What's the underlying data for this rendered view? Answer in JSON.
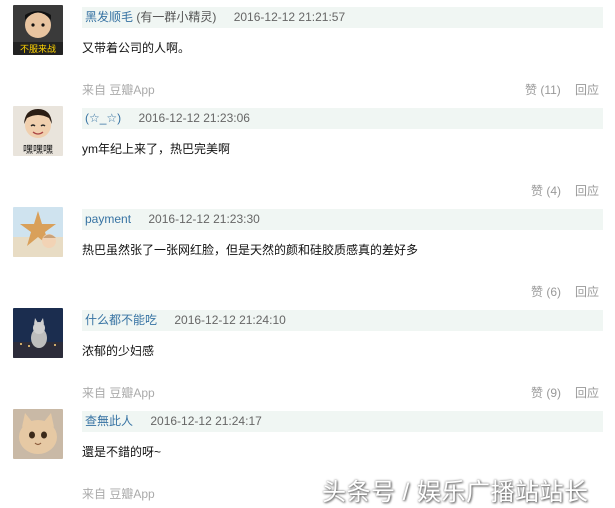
{
  "comments": [
    {
      "username": "黑发顺毛",
      "user_subtitle": "(有一群小精灵)",
      "timestamp": "2016-12-12 21:21:57",
      "text": "又带着公司的人啊。",
      "source": "来自 豆瓣App",
      "likes": "赞 (11)",
      "reply": "回应",
      "avatar_caption": "不服来战"
    },
    {
      "username": "(☆_☆)",
      "user_subtitle": "",
      "timestamp": "2016-12-12 21:23:06",
      "text": "ym年纪上来了，热巴完美啊",
      "source": "",
      "likes": "赞 (4)",
      "reply": "回应",
      "avatar_caption": "嘿嘿嘿"
    },
    {
      "username": "payment",
      "user_subtitle": "",
      "timestamp": "2016-12-12 21:23:30",
      "text": "热巴虽然张了一张网红脸，但是天然的颜和硅胶质感真的差好多",
      "source": "",
      "likes": "赞 (6)",
      "reply": "回应",
      "avatar_caption": ""
    },
    {
      "username": "什么都不能吃",
      "user_subtitle": "",
      "timestamp": "2016-12-12 21:24:10",
      "text": "浓郁的少妇感",
      "source": "来自 豆瓣App",
      "likes": "赞 (9)",
      "reply": "回应",
      "avatar_caption": ""
    },
    {
      "username": "查無此人",
      "user_subtitle": "",
      "timestamp": "2016-12-12 21:24:17",
      "text": "還是不錯的呀~",
      "source": "来自 豆瓣App",
      "likes": "",
      "reply": "",
      "avatar_caption": ""
    }
  ],
  "watermark": "头条号 / 娱乐广播站站长",
  "colors": {
    "username": "#3773a3",
    "header_bg": "#f0f6f3",
    "meta_gray": "#999999"
  }
}
